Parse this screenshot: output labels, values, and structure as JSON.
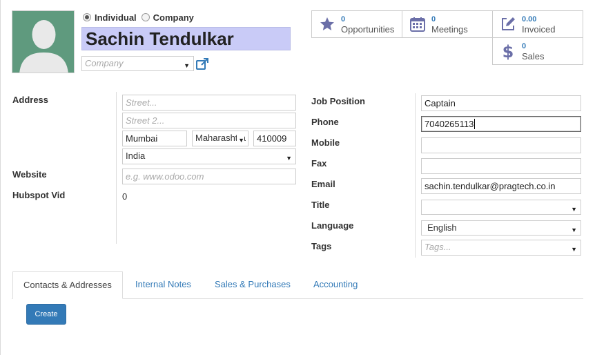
{
  "partner": {
    "type_options": [
      "Individual",
      "Company"
    ],
    "selected_type": "Individual",
    "name": "Sachin Tendulkar",
    "company_placeholder": "Company"
  },
  "stats": [
    {
      "value": "0",
      "label": "Opportunities",
      "icon": "star-icon"
    },
    {
      "value": "0",
      "label": "Meetings",
      "icon": "calendar-icon"
    },
    {
      "value": "0.00",
      "label": "Invoiced",
      "icon": "pencil-square-icon"
    },
    {
      "value": "0",
      "label": "Sales",
      "icon": "dollar-icon"
    }
  ],
  "address": {
    "label": "Address",
    "street_placeholder": "Street...",
    "street2_placeholder": "Street 2...",
    "city": "Mumbai",
    "state": "Maharashtra",
    "zip": "410009",
    "country": "India"
  },
  "website": {
    "label": "Website",
    "placeholder": "e.g. www.odoo.com"
  },
  "hubspot": {
    "label": "Hubspot Vid",
    "value": "0"
  },
  "contact": {
    "job_label": "Job Position",
    "job_value": "Captain",
    "phone_label": "Phone",
    "phone_value": "7040265113",
    "mobile_label": "Mobile",
    "mobile_value": "",
    "fax_label": "Fax",
    "fax_value": "",
    "email_label": "Email",
    "email_value": "sachin.tendulkar@pragtech.co.in",
    "title_label": "Title",
    "title_value": "",
    "language_label": "Language",
    "language_value": "English",
    "tags_label": "Tags",
    "tags_placeholder": "Tags..."
  },
  "tabs": [
    "Contacts & Addresses",
    "Internal Notes",
    "Sales & Purchases",
    "Accounting"
  ],
  "active_tab": "Contacts & Addresses",
  "create_label": "Create",
  "colors": {
    "accent": "#337ab7",
    "name_highlight": "#c9cbf7",
    "avatar_bg": "#5f9a7e",
    "icon": "#6b6fa8"
  }
}
